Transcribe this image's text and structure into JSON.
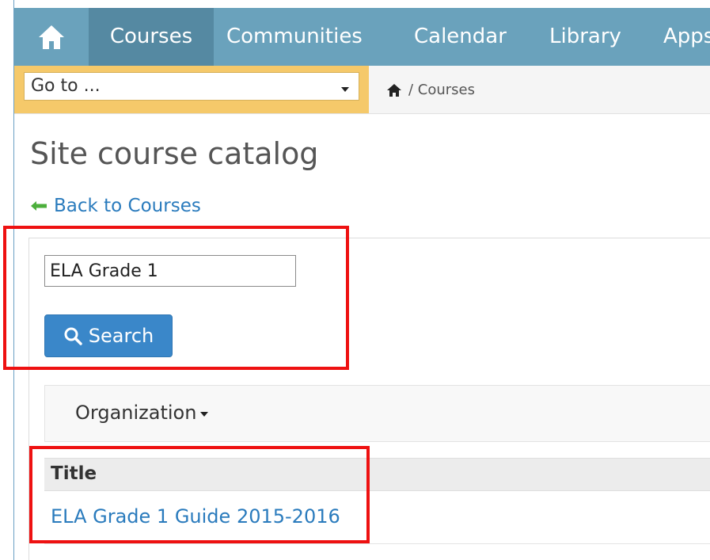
{
  "nav": {
    "items": [
      {
        "label": "Courses",
        "active": true
      },
      {
        "label": "Communities",
        "active": false
      },
      {
        "label": "Calendar",
        "active": false
      },
      {
        "label": "Library",
        "active": false
      },
      {
        "label": "Apps",
        "active": false
      }
    ],
    "home_icon": "home-icon"
  },
  "goto": {
    "selected": "Go to ..."
  },
  "breadcrumb": {
    "home_icon": "home-icon",
    "text": "/ Courses"
  },
  "page": {
    "title": "Site course catalog",
    "back_link": "Back to Courses"
  },
  "search": {
    "value": "ELA Grade 1",
    "button_label": "Search"
  },
  "filter": {
    "organization_label": "Organization"
  },
  "table": {
    "columns": [
      "Title"
    ],
    "rows": [
      {
        "title": "ELA Grade 1 Guide 2015-2016"
      }
    ]
  },
  "colors": {
    "nav_bg": "#6aa2bc",
    "nav_active": "#5589a2",
    "goto_accent": "#f5c96a",
    "link": "#2a7bbd",
    "button": "#3a87c9",
    "annotation": "#ee1111"
  }
}
